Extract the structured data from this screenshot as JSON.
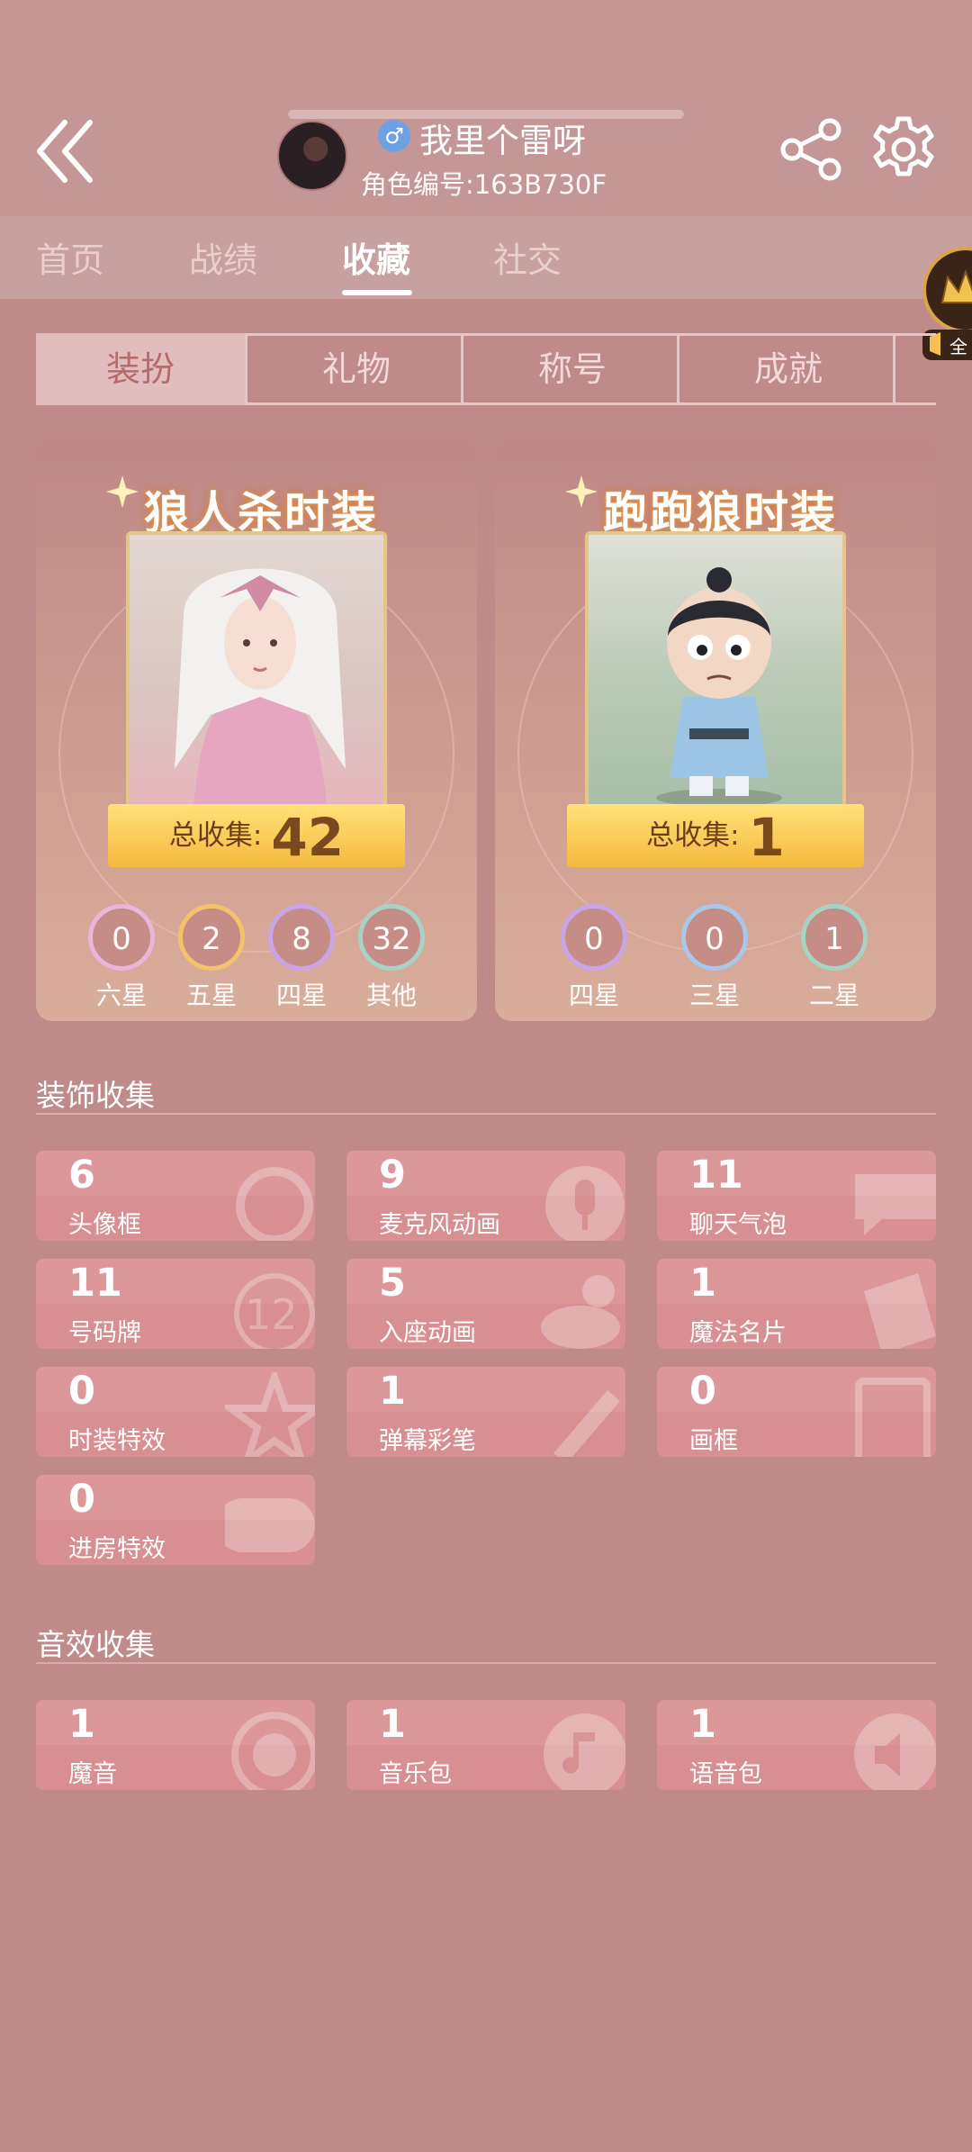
{
  "header": {
    "gender_symbol": "♂",
    "username": "我里个雷呀",
    "role_id": "角色编号:163B730F"
  },
  "nav_tabs": [
    "首页",
    "战绩",
    "收藏",
    "社交"
  ],
  "sub_tabs": [
    "装扮",
    "礼物",
    "称号",
    "成就"
  ],
  "badge_text": "全",
  "collections": [
    {
      "title": "狼人杀时装",
      "total_label": "总收集:",
      "total": "42",
      "stars": [
        {
          "value": "0",
          "label": "六星",
          "color": "#e8b6d8"
        },
        {
          "value": "2",
          "label": "五星",
          "color": "#f3c26a"
        },
        {
          "value": "8",
          "label": "四星",
          "color": "#c9a4e6"
        },
        {
          "value": "32",
          "label": "其他",
          "color": "#a7d3c5"
        }
      ]
    },
    {
      "title": "跑跑狼时装",
      "total_label": "总收集:",
      "total": "1",
      "stars": [
        {
          "value": "0",
          "label": "四星",
          "color": "#c9a4e6"
        },
        {
          "value": "0",
          "label": "三星",
          "color": "#a9c7ea"
        },
        {
          "value": "1",
          "label": "二星",
          "color": "#a7d3c5"
        }
      ]
    }
  ],
  "decor_section": {
    "title": "装饰收集",
    "items": [
      {
        "value": "6",
        "label": "头像框"
      },
      {
        "value": "9",
        "label": "麦克风动画"
      },
      {
        "value": "11",
        "label": "聊天气泡"
      },
      {
        "value": "11",
        "label": "号码牌"
      },
      {
        "value": "5",
        "label": "入座动画"
      },
      {
        "value": "1",
        "label": "魔法名片"
      },
      {
        "value": "0",
        "label": "时装特效"
      },
      {
        "value": "1",
        "label": "弹幕彩笔"
      },
      {
        "value": "0",
        "label": "画框"
      },
      {
        "value": "0",
        "label": "进房特效"
      }
    ]
  },
  "sound_section": {
    "title": "音效收集",
    "items": [
      {
        "value": "1",
        "label": "魔音"
      },
      {
        "value": "1",
        "label": "音乐包"
      },
      {
        "value": "1",
        "label": "语音包"
      }
    ]
  },
  "deco_text": {
    "number_plate": "12"
  }
}
